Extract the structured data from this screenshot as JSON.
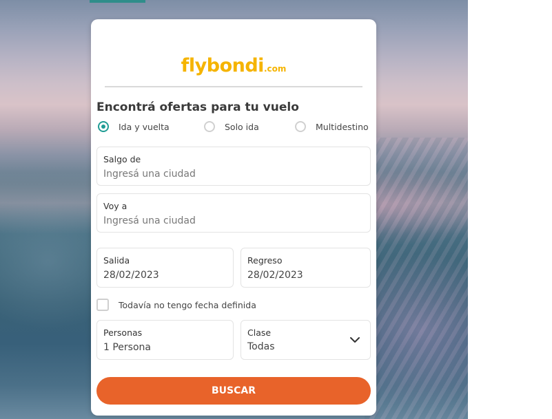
{
  "brand": {
    "name": "flybondi",
    "suffix": ".com",
    "color": "#f5b400"
  },
  "form": {
    "heading": "Encontrá ofertas para tu vuelo",
    "trip_types": [
      {
        "label": "Ida y vuelta",
        "selected": true
      },
      {
        "label": "Solo ida",
        "selected": false
      },
      {
        "label": "Multidestino",
        "selected": false
      }
    ],
    "origin": {
      "label": "Salgo de",
      "placeholder": "Ingresá una ciudad"
    },
    "destination": {
      "label": "Voy a",
      "placeholder": "Ingresá una ciudad"
    },
    "departure": {
      "label": "Salida",
      "value": "28/02/2023"
    },
    "return": {
      "label": "Regreso",
      "value": "28/02/2023"
    },
    "no_date": {
      "label": "Todavía no tengo fecha definida",
      "checked": false
    },
    "passengers": {
      "label": "Personas",
      "value": "1 Persona"
    },
    "cabin_class": {
      "label": "Clase",
      "value": "Todas",
      "icon": "chevron-down-icon"
    },
    "search_label": "BUSCAR"
  },
  "colors": {
    "accent_teal": "#1f9c94",
    "button_orange": "#e8632a",
    "tab_indicator": "#2f8d8a"
  }
}
